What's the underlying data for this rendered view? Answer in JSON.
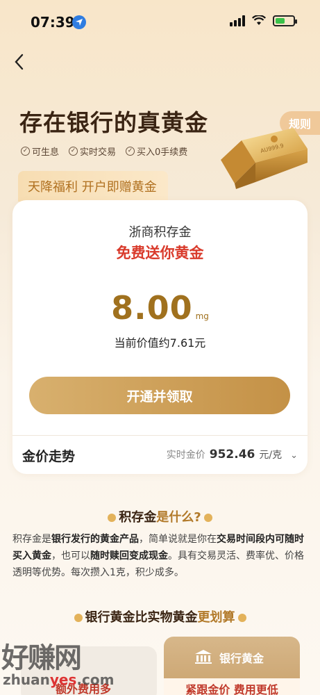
{
  "status_bar": {
    "time": "07:39"
  },
  "hero": {
    "title": "存在银行的真黄金",
    "features": [
      "可生息",
      "实时交易",
      "买入0手续费"
    ],
    "rules_label": "规则",
    "gold_bar_text": "AU999.9",
    "promo": "天降福利 开户即赠黄金"
  },
  "card": {
    "product": "浙商积存金",
    "headline": "免费送你黄金",
    "amount": "8.00",
    "amount_unit": "mg",
    "worth": "当前价值约7.61元",
    "cta": "开通并领取",
    "trend_label": "金价走势",
    "price_label": "实时金价",
    "price": "952.46",
    "price_unit": "元/克"
  },
  "what_is": {
    "title_main": "积存金",
    "title_gold": "是什么?",
    "p1": "积存金是",
    "b1": "银行发行的黄金产品",
    "p2": "，简单说就是你在",
    "b2": "交易时间段内可随时买入黄金",
    "p3": "，也可以",
    "b3": "随时赎回变成现金",
    "p4": "。具有交易灵活、费率优、价格透明等优势。每次攒入1克，积少成多。"
  },
  "compare": {
    "title_main": "银行黄金比实物黄金",
    "title_gold": "更划算",
    "left_text": "额外费用多",
    "right_head": "银行黄金",
    "right_sub": "紧跟金价 费用更低"
  },
  "watermark": {
    "brand": "好赚网",
    "url_a": "zhuan",
    "url_b": "yes",
    "url_c": ".com"
  }
}
